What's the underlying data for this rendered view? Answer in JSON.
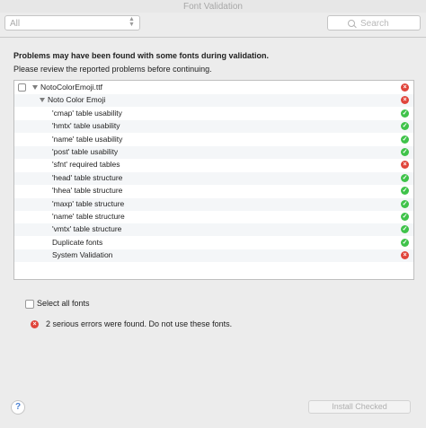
{
  "window": {
    "title": "Font Validation"
  },
  "toolbar": {
    "filter_value": "All",
    "search_placeholder": "Search"
  },
  "header": {
    "title": "Problems may have been found with some fonts during validation.",
    "subtitle": "Please review the reported problems before continuing."
  },
  "tree": [
    {
      "label": "NotoColorEmoji.ttf",
      "status": "error",
      "level": 0,
      "checkbox": true,
      "expanded": true
    },
    {
      "label": "Noto Color Emoji",
      "status": "error",
      "level": 1,
      "checkbox": false,
      "expanded": true
    },
    {
      "label": "'cmap' table usability",
      "status": "ok",
      "level": 2,
      "checkbox": false
    },
    {
      "label": "'hmtx' table usability",
      "status": "ok",
      "level": 2,
      "checkbox": false
    },
    {
      "label": "'name' table usability",
      "status": "ok",
      "level": 2,
      "checkbox": false
    },
    {
      "label": "'post' table usability",
      "status": "ok",
      "level": 2,
      "checkbox": false
    },
    {
      "label": "'sfnt' required tables",
      "status": "error",
      "level": 2,
      "checkbox": false
    },
    {
      "label": "'head' table structure",
      "status": "ok",
      "level": 2,
      "checkbox": false
    },
    {
      "label": "'hhea' table structure",
      "status": "ok",
      "level": 2,
      "checkbox": false
    },
    {
      "label": "'maxp' table structure",
      "status": "ok",
      "level": 2,
      "checkbox": false
    },
    {
      "label": "'name' table structure",
      "status": "ok",
      "level": 2,
      "checkbox": false
    },
    {
      "label": "'vmtx' table structure",
      "status": "ok",
      "level": 2,
      "checkbox": false
    },
    {
      "label": "Duplicate fonts",
      "status": "ok",
      "level": 2,
      "checkbox": false
    },
    {
      "label": "System Validation",
      "status": "error",
      "level": 2,
      "checkbox": false
    }
  ],
  "select_all": {
    "label": "Select all fonts",
    "checked": false
  },
  "message": {
    "text": "2 serious errors were found. Do not use these fonts.",
    "icon": "error-icon"
  },
  "footer": {
    "help_label": "?",
    "install_label": "Install Checked"
  },
  "icons": {
    "error_glyph": "×",
    "ok_glyph": "✓"
  },
  "colors": {
    "error": "#e0453b",
    "ok": "#3fc34a",
    "accent": "#4a80d2"
  }
}
